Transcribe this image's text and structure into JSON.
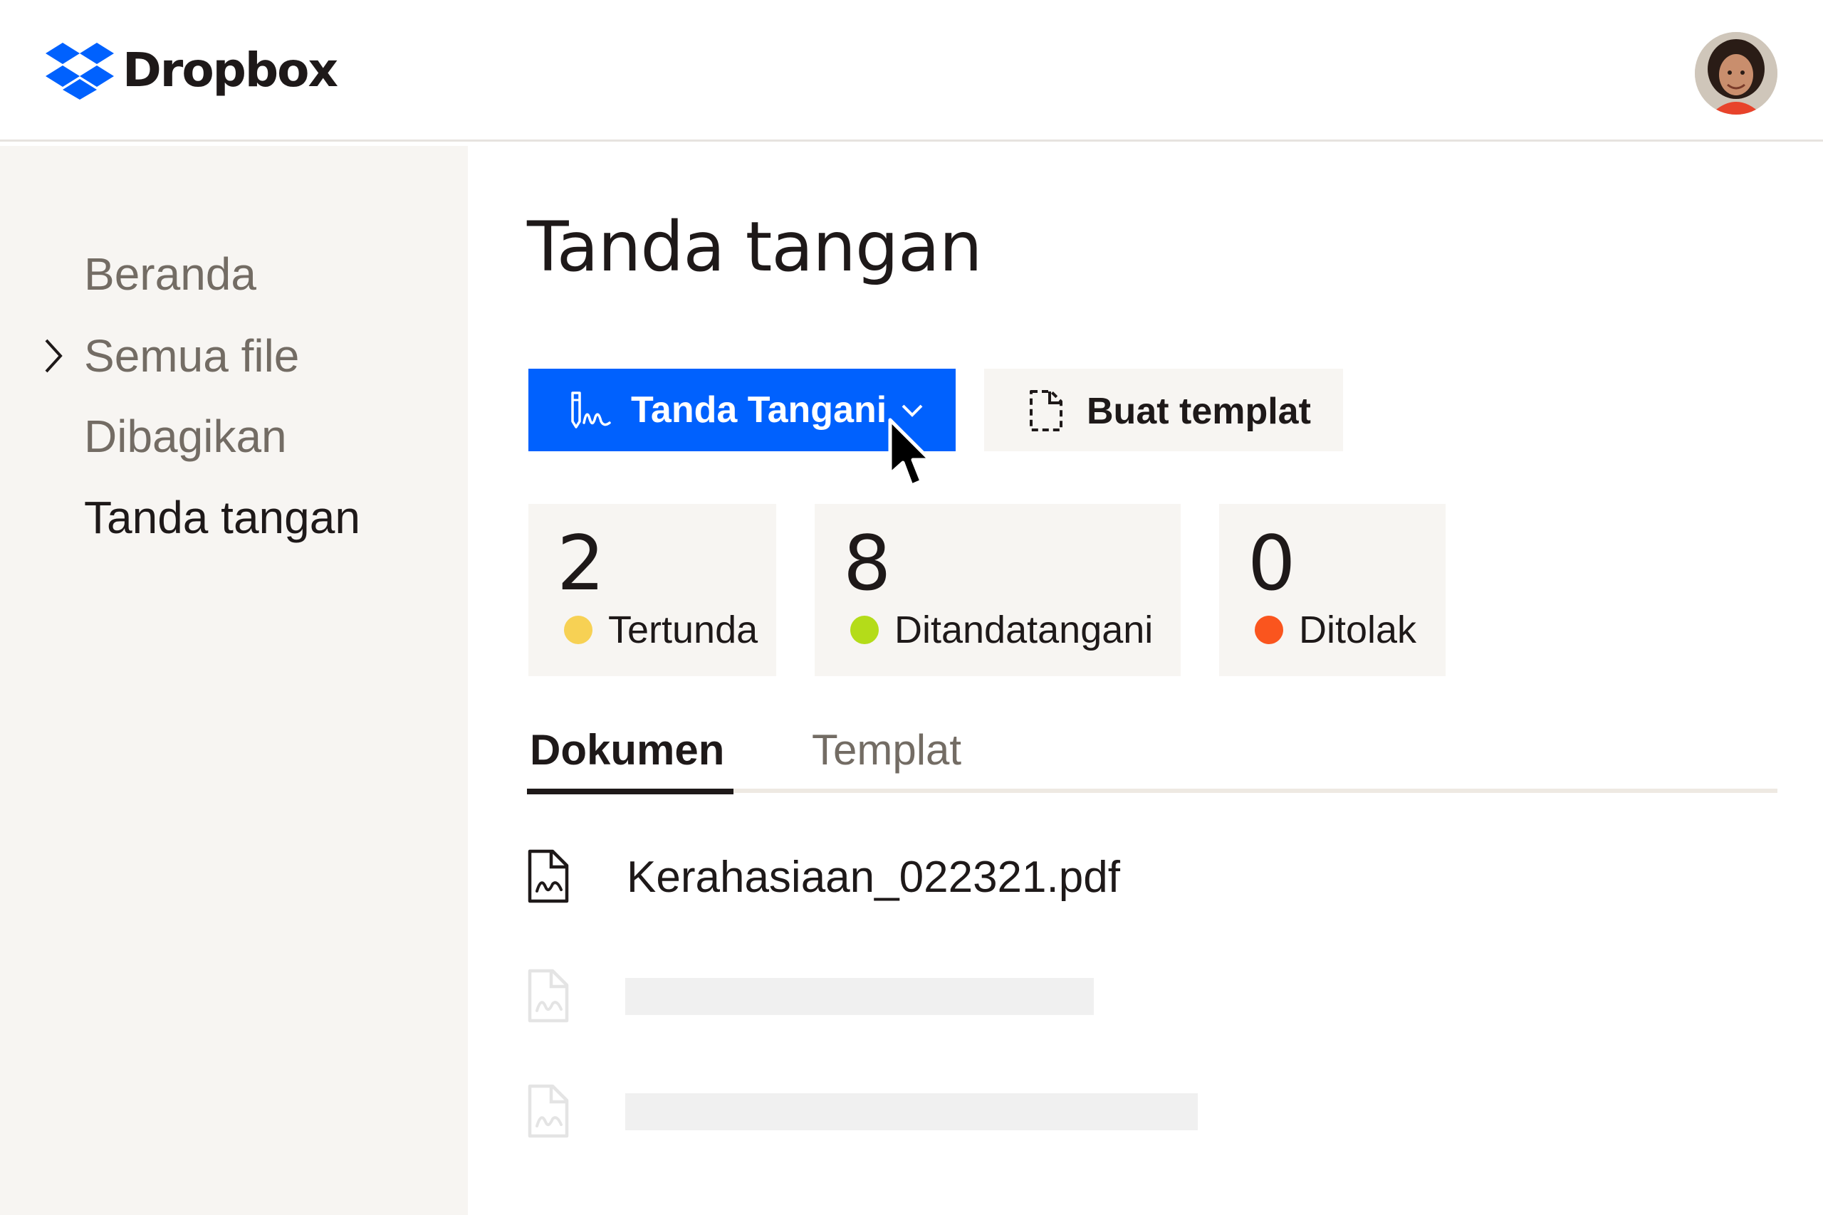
{
  "app": {
    "brand": "Dropbox"
  },
  "header": {
    "avatar_icon": "user-avatar"
  },
  "sidebar": {
    "items": [
      {
        "label": "Beranda",
        "active": false,
        "has_chevron": false
      },
      {
        "label": "Semua file",
        "active": false,
        "has_chevron": true
      },
      {
        "label": "Dibagikan",
        "active": false,
        "has_chevron": false
      },
      {
        "label": "Tanda tangan",
        "active": true,
        "has_chevron": false
      }
    ]
  },
  "main": {
    "title": "Tanda tangan",
    "primary_button": {
      "label": "Tanda Tangani",
      "icon": "signature-pen-icon"
    },
    "secondary_button": {
      "label": "Buat templat",
      "icon": "template-document-icon"
    },
    "stats": [
      {
        "value": "2",
        "label": "Tertunda",
        "color": "#f7d154"
      },
      {
        "value": "8",
        "label": "Ditandatangani",
        "color": "#b4dc19"
      },
      {
        "value": "0",
        "label": "Ditolak",
        "color": "#fa551e"
      }
    ],
    "tabs": [
      {
        "label": "Dokumen",
        "active": true
      },
      {
        "label": "Templat",
        "active": false
      }
    ],
    "documents": [
      {
        "name": "Kerahasiaan_022321.pdf",
        "icon": "signed-document-icon"
      }
    ]
  },
  "colors": {
    "accent": "#0061fe",
    "sidebar_bg": "#f7f5f2",
    "text_primary": "#1e1919",
    "text_muted": "#736c64"
  }
}
